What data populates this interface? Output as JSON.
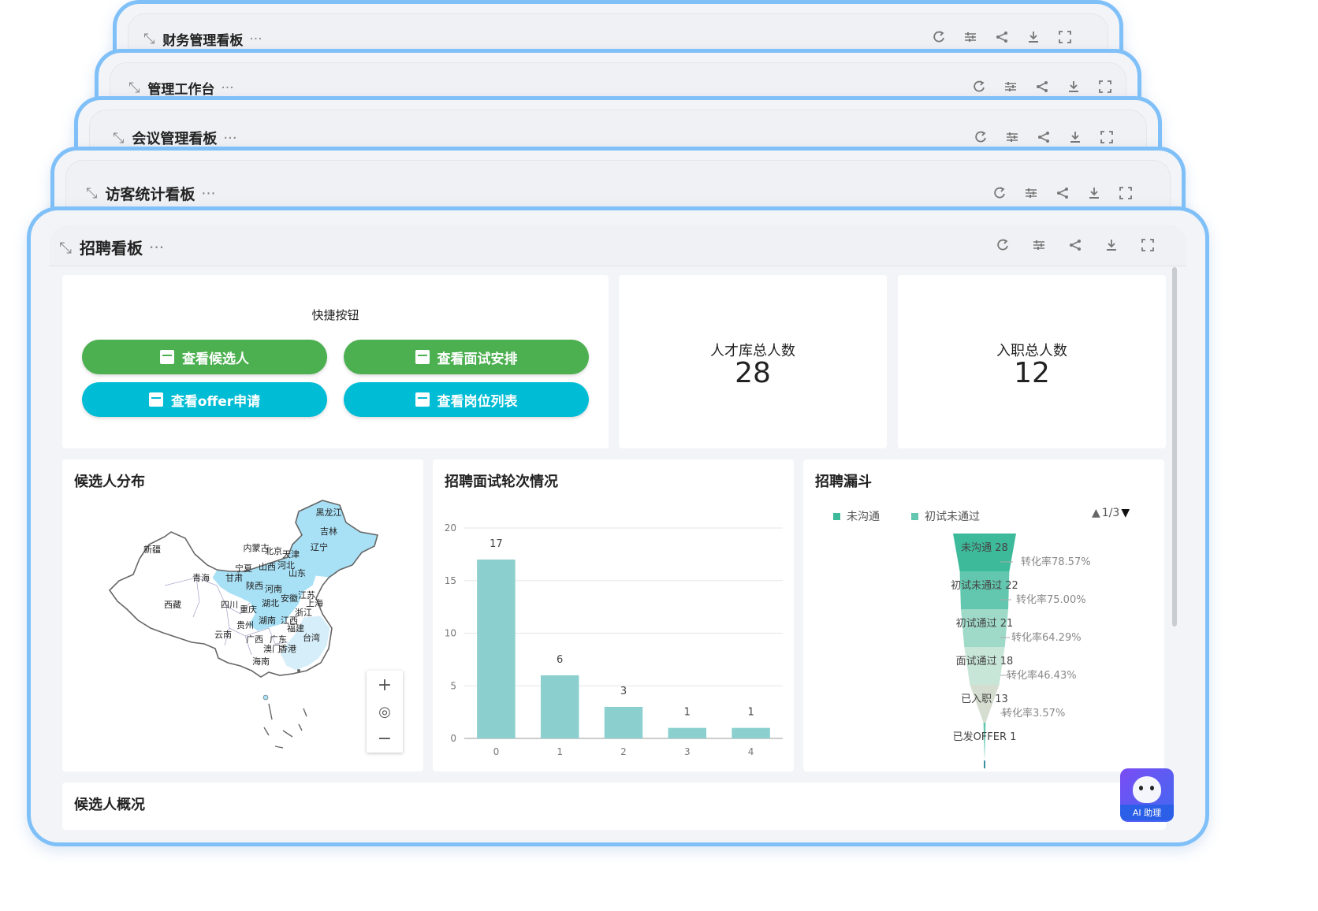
{
  "stack": [
    {
      "title": "财务管理看板"
    },
    {
      "title": "管理工作台"
    },
    {
      "title": "会议管理看板"
    },
    {
      "title": "访客统计看板"
    }
  ],
  "main": {
    "title": "招聘看板",
    "quick": {
      "title": "快捷按钮",
      "buttons": [
        "查看候选人",
        "查看面试安排",
        "查看offer申请",
        "查看岗位列表"
      ]
    },
    "stats": [
      {
        "label": "人才库总人数",
        "value": "28"
      },
      {
        "label": "入职总人数",
        "value": "12"
      }
    ],
    "map": {
      "title": "候选人分布",
      "provinces": [
        "黑龙江",
        "吉林",
        "辽宁",
        "内蒙古",
        "北京",
        "天津",
        "河北",
        "山西",
        "山东",
        "新疆",
        "青海",
        "甘肃",
        "宁夏",
        "陕西",
        "河南",
        "西藏",
        "四川",
        "重庆",
        "湖北",
        "安徽",
        "江苏",
        "上海",
        "浙江",
        "贵州",
        "湖南",
        "江西",
        "福建",
        "云南",
        "广西",
        "广东",
        "澳门",
        "香港",
        "台湾",
        "海南"
      ]
    },
    "bar": {
      "title": "招聘面试轮次情况"
    },
    "funnel": {
      "title": "招聘漏斗",
      "legend": [
        "未沟通",
        "初试未通过"
      ],
      "pager": "1/3"
    },
    "bottom": {
      "title": "候选人概况"
    },
    "ai": {
      "label": "AI 助理"
    }
  },
  "colors": {
    "accent": "#80c0f8",
    "green": "#4caf50",
    "cyan": "#00bcd4",
    "bar": "#8ccfcf"
  },
  "chart_data": [
    {
      "type": "bar",
      "title": "招聘面试轮次情况",
      "categories": [
        "0",
        "1",
        "2",
        "3",
        "4"
      ],
      "values": [
        17,
        6,
        3,
        1,
        1
      ],
      "ylim": [
        0,
        20
      ],
      "yticks": [
        0,
        5,
        10,
        15,
        20
      ],
      "grid": true
    },
    {
      "type": "funnel",
      "title": "招聘漏斗",
      "stages": [
        {
          "name": "未沟通",
          "value": 28,
          "label": "未沟通 28"
        },
        {
          "name": "初试未通过",
          "value": 22,
          "label": "初试未通过 22"
        },
        {
          "name": "初试通过",
          "value": 21,
          "label": "初试通过 21"
        },
        {
          "name": "面试通过",
          "value": 18,
          "label": "面试通过 18"
        },
        {
          "name": "已入职",
          "value": 13,
          "label": "已入职 13"
        },
        {
          "name": "已发OFFER",
          "value": 1,
          "label": "已发OFFER 1"
        }
      ],
      "rates": [
        "转化率78.57%",
        "转化率75.00%",
        "转化率64.29%",
        "转化率46.43%",
        "转化率3.57%"
      ]
    }
  ]
}
